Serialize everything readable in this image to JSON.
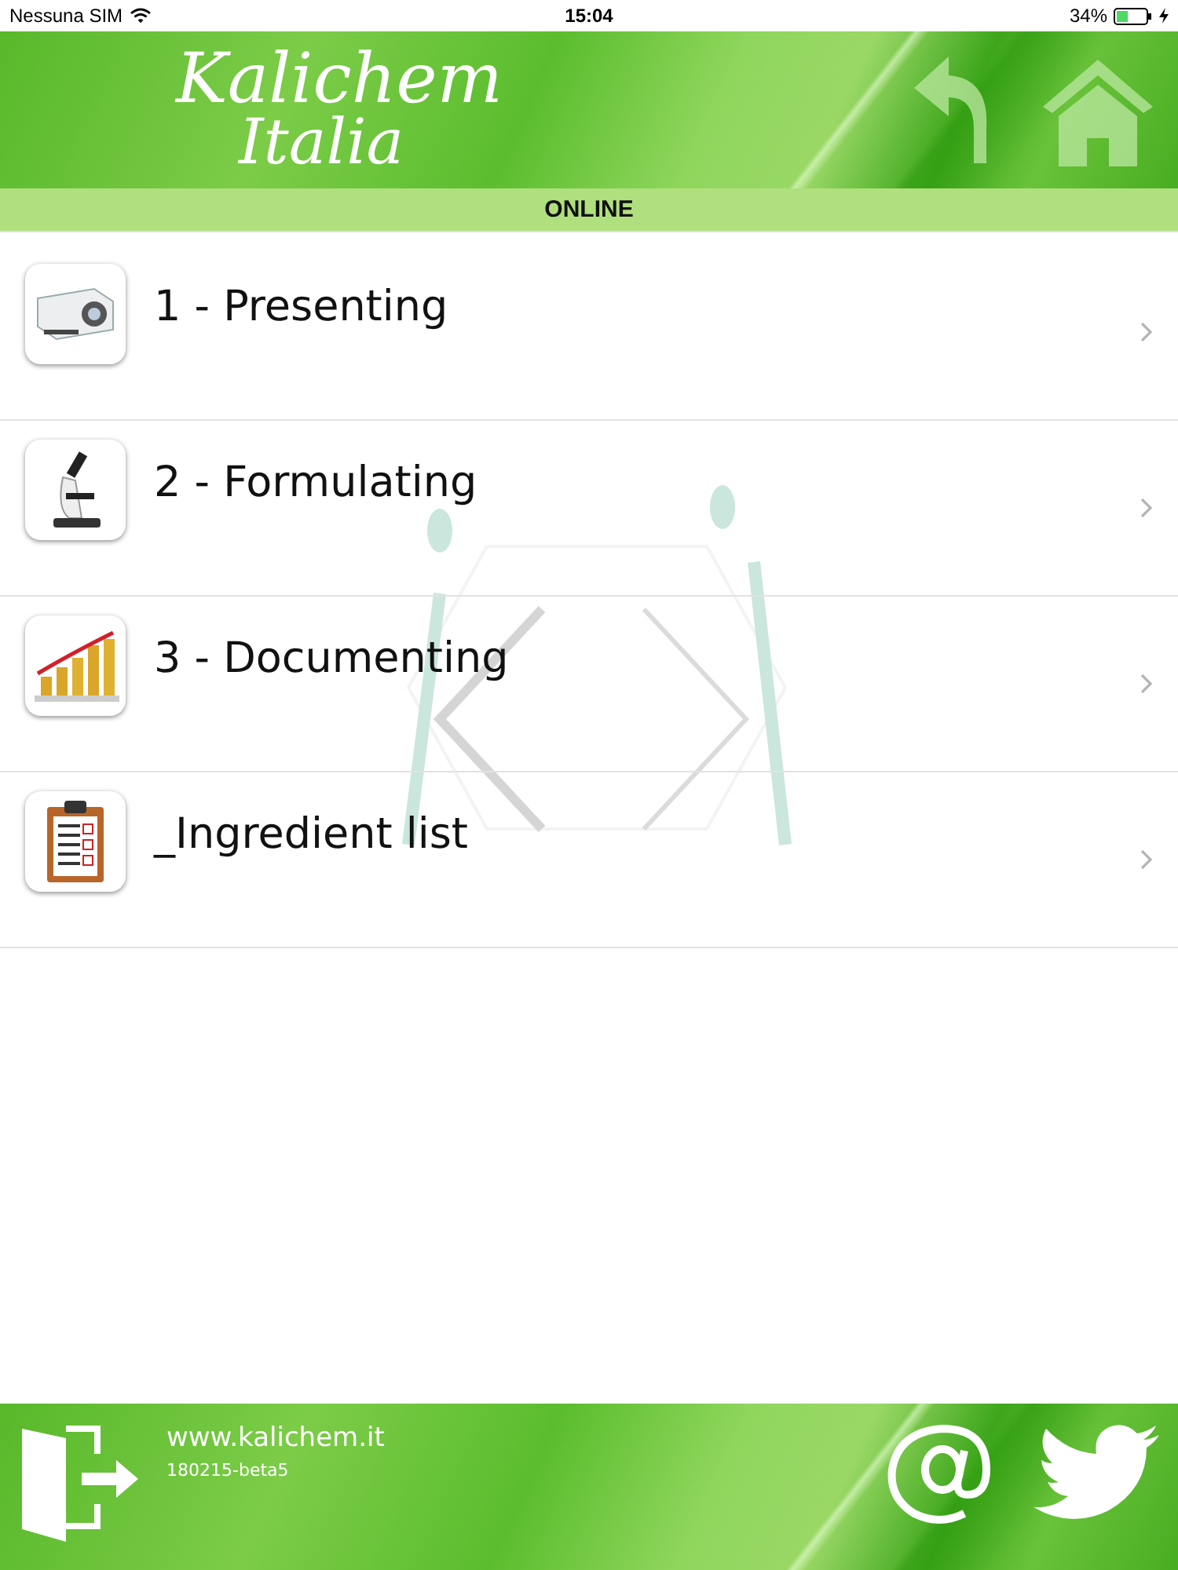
{
  "status_bar": {
    "carrier": "Nessuna SIM",
    "time": "15:04",
    "battery": "34%"
  },
  "header": {
    "logo_line_1": "Kalichem",
    "logo_line_2": "Italia"
  },
  "connection": {
    "label": "ONLINE"
  },
  "menu": [
    {
      "kind": "projector",
      "label": "1 - Presenting"
    },
    {
      "kind": "microscope",
      "label": "2 - Formulating"
    },
    {
      "kind": "chart",
      "label": "3 - Documenting"
    },
    {
      "kind": "clipboard",
      "label": "_Ingredient list"
    }
  ],
  "footer": {
    "website": "www.kalichem.it",
    "version": "180215-beta5"
  }
}
